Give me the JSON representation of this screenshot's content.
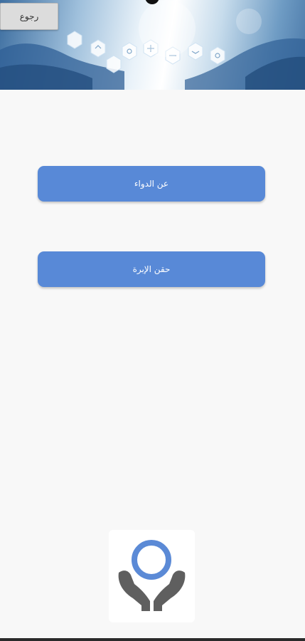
{
  "header": {
    "back_label": "رجوع"
  },
  "main": {
    "buttons": [
      {
        "label": "عن الدواء"
      },
      {
        "label": "حقن الإبرة"
      }
    ]
  },
  "icons": {
    "logo": "hands-holding-ring-icon",
    "banner": "medical-hexagon-banner-image"
  },
  "colors": {
    "button_bg": "#5889d7",
    "button_text": "#ffffff",
    "page_bg": "#f8f8f8",
    "back_button_bg": "#dcdcdc",
    "logo_ring": "#5b8ad6",
    "logo_hands": "#5f5f5f"
  }
}
